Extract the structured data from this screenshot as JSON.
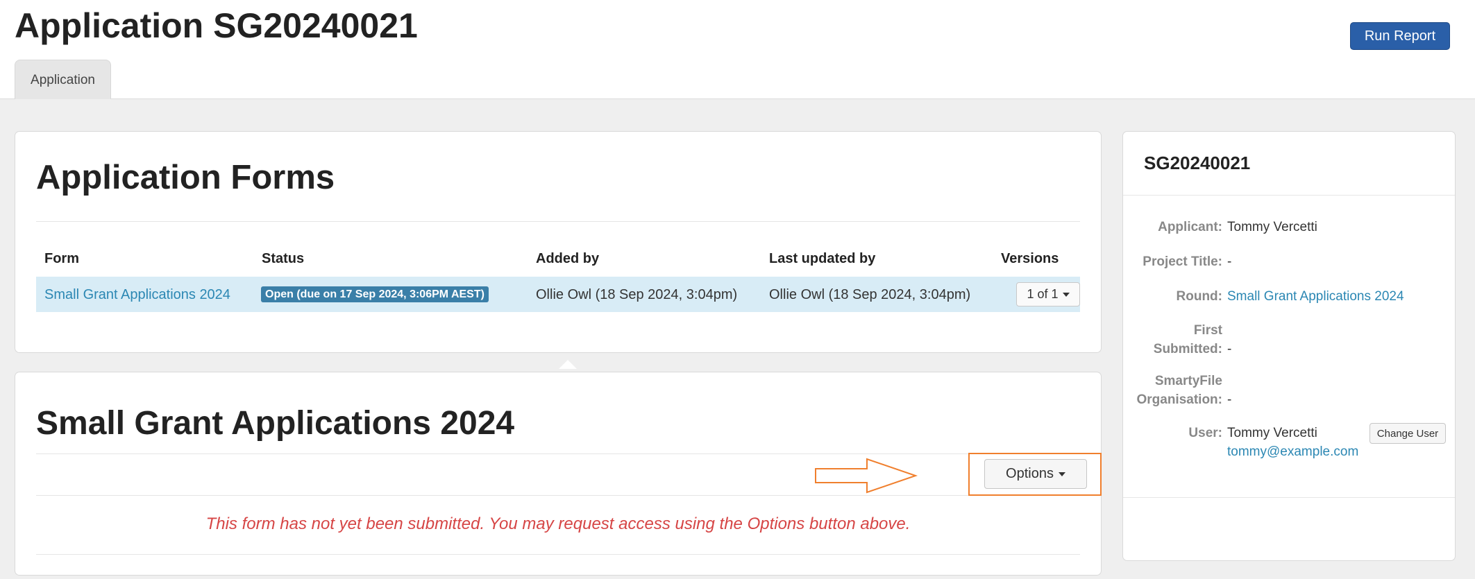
{
  "header": {
    "title": "Application SG20240021",
    "run_report_label": "Run Report",
    "tabs": [
      {
        "label": "Application"
      }
    ]
  },
  "forms_panel": {
    "title": "Application Forms",
    "columns": [
      "Form",
      "Status",
      "Added by",
      "Last updated by",
      "Versions"
    ],
    "rows": [
      {
        "form": "Small Grant Applications 2024",
        "status": "Open (due on 17 Sep 2024, 3:06PM AEST)",
        "added_by": "Ollie Owl (18 Sep 2024, 3:04pm)",
        "last_updated_by": "Ollie Owl (18 Sep 2024, 3:04pm)",
        "versions": "1 of 1"
      }
    ]
  },
  "form_detail": {
    "title": "Small Grant Applications 2024",
    "options_label": "Options",
    "notice": "This form has not yet been submitted. You may request access using the Options button above."
  },
  "sidebar": {
    "title": "SG20240021",
    "fields": [
      {
        "label": "Applicant:",
        "value": "Tommy Vercetti"
      },
      {
        "label": "Project Title:",
        "value": "-"
      },
      {
        "label": "Round:",
        "value": "Small Grant Applications 2024"
      },
      {
        "label_line1": "First",
        "label_line2": "Submitted:",
        "value": "-"
      },
      {
        "label_line1": "SmartyFile",
        "label_line2": "Organisation:",
        "value": "-"
      },
      {
        "label": "User:",
        "value": "Tommy Vercetti",
        "email": "tommy@example.com"
      }
    ],
    "change_user_label": "Change User"
  },
  "colors": {
    "primary": "#2a5fa8",
    "link": "#2b87b3",
    "status_badge": "#3a7fa8",
    "row_highlight": "#d8ecf6",
    "notice": "#d64545",
    "annotation": "#f07f2d"
  }
}
